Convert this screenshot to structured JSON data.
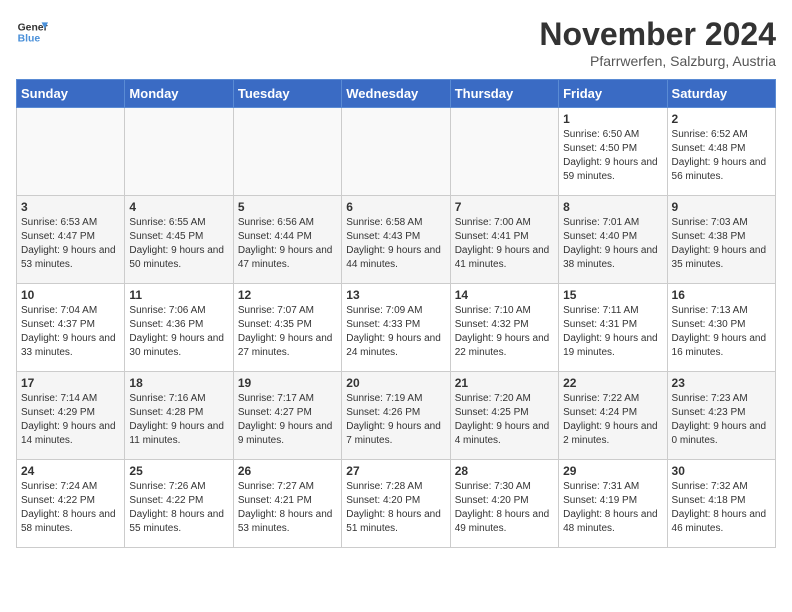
{
  "logo": {
    "line1": "General",
    "line2": "Blue"
  },
  "title": "November 2024",
  "subtitle": "Pfarrwerfen, Salzburg, Austria",
  "weekdays": [
    "Sunday",
    "Monday",
    "Tuesday",
    "Wednesday",
    "Thursday",
    "Friday",
    "Saturday"
  ],
  "weeks": [
    [
      {
        "day": "",
        "info": ""
      },
      {
        "day": "",
        "info": ""
      },
      {
        "day": "",
        "info": ""
      },
      {
        "day": "",
        "info": ""
      },
      {
        "day": "",
        "info": ""
      },
      {
        "day": "1",
        "info": "Sunrise: 6:50 AM\nSunset: 4:50 PM\nDaylight: 9 hours and 59 minutes."
      },
      {
        "day": "2",
        "info": "Sunrise: 6:52 AM\nSunset: 4:48 PM\nDaylight: 9 hours and 56 minutes."
      }
    ],
    [
      {
        "day": "3",
        "info": "Sunrise: 6:53 AM\nSunset: 4:47 PM\nDaylight: 9 hours and 53 minutes."
      },
      {
        "day": "4",
        "info": "Sunrise: 6:55 AM\nSunset: 4:45 PM\nDaylight: 9 hours and 50 minutes."
      },
      {
        "day": "5",
        "info": "Sunrise: 6:56 AM\nSunset: 4:44 PM\nDaylight: 9 hours and 47 minutes."
      },
      {
        "day": "6",
        "info": "Sunrise: 6:58 AM\nSunset: 4:43 PM\nDaylight: 9 hours and 44 minutes."
      },
      {
        "day": "7",
        "info": "Sunrise: 7:00 AM\nSunset: 4:41 PM\nDaylight: 9 hours and 41 minutes."
      },
      {
        "day": "8",
        "info": "Sunrise: 7:01 AM\nSunset: 4:40 PM\nDaylight: 9 hours and 38 minutes."
      },
      {
        "day": "9",
        "info": "Sunrise: 7:03 AM\nSunset: 4:38 PM\nDaylight: 9 hours and 35 minutes."
      }
    ],
    [
      {
        "day": "10",
        "info": "Sunrise: 7:04 AM\nSunset: 4:37 PM\nDaylight: 9 hours and 33 minutes."
      },
      {
        "day": "11",
        "info": "Sunrise: 7:06 AM\nSunset: 4:36 PM\nDaylight: 9 hours and 30 minutes."
      },
      {
        "day": "12",
        "info": "Sunrise: 7:07 AM\nSunset: 4:35 PM\nDaylight: 9 hours and 27 minutes."
      },
      {
        "day": "13",
        "info": "Sunrise: 7:09 AM\nSunset: 4:33 PM\nDaylight: 9 hours and 24 minutes."
      },
      {
        "day": "14",
        "info": "Sunrise: 7:10 AM\nSunset: 4:32 PM\nDaylight: 9 hours and 22 minutes."
      },
      {
        "day": "15",
        "info": "Sunrise: 7:11 AM\nSunset: 4:31 PM\nDaylight: 9 hours and 19 minutes."
      },
      {
        "day": "16",
        "info": "Sunrise: 7:13 AM\nSunset: 4:30 PM\nDaylight: 9 hours and 16 minutes."
      }
    ],
    [
      {
        "day": "17",
        "info": "Sunrise: 7:14 AM\nSunset: 4:29 PM\nDaylight: 9 hours and 14 minutes."
      },
      {
        "day": "18",
        "info": "Sunrise: 7:16 AM\nSunset: 4:28 PM\nDaylight: 9 hours and 11 minutes."
      },
      {
        "day": "19",
        "info": "Sunrise: 7:17 AM\nSunset: 4:27 PM\nDaylight: 9 hours and 9 minutes."
      },
      {
        "day": "20",
        "info": "Sunrise: 7:19 AM\nSunset: 4:26 PM\nDaylight: 9 hours and 7 minutes."
      },
      {
        "day": "21",
        "info": "Sunrise: 7:20 AM\nSunset: 4:25 PM\nDaylight: 9 hours and 4 minutes."
      },
      {
        "day": "22",
        "info": "Sunrise: 7:22 AM\nSunset: 4:24 PM\nDaylight: 9 hours and 2 minutes."
      },
      {
        "day": "23",
        "info": "Sunrise: 7:23 AM\nSunset: 4:23 PM\nDaylight: 9 hours and 0 minutes."
      }
    ],
    [
      {
        "day": "24",
        "info": "Sunrise: 7:24 AM\nSunset: 4:22 PM\nDaylight: 8 hours and 58 minutes."
      },
      {
        "day": "25",
        "info": "Sunrise: 7:26 AM\nSunset: 4:22 PM\nDaylight: 8 hours and 55 minutes."
      },
      {
        "day": "26",
        "info": "Sunrise: 7:27 AM\nSunset: 4:21 PM\nDaylight: 8 hours and 53 minutes."
      },
      {
        "day": "27",
        "info": "Sunrise: 7:28 AM\nSunset: 4:20 PM\nDaylight: 8 hours and 51 minutes."
      },
      {
        "day": "28",
        "info": "Sunrise: 7:30 AM\nSunset: 4:20 PM\nDaylight: 8 hours and 49 minutes."
      },
      {
        "day": "29",
        "info": "Sunrise: 7:31 AM\nSunset: 4:19 PM\nDaylight: 8 hours and 48 minutes."
      },
      {
        "day": "30",
        "info": "Sunrise: 7:32 AM\nSunset: 4:18 PM\nDaylight: 8 hours and 46 minutes."
      }
    ]
  ]
}
